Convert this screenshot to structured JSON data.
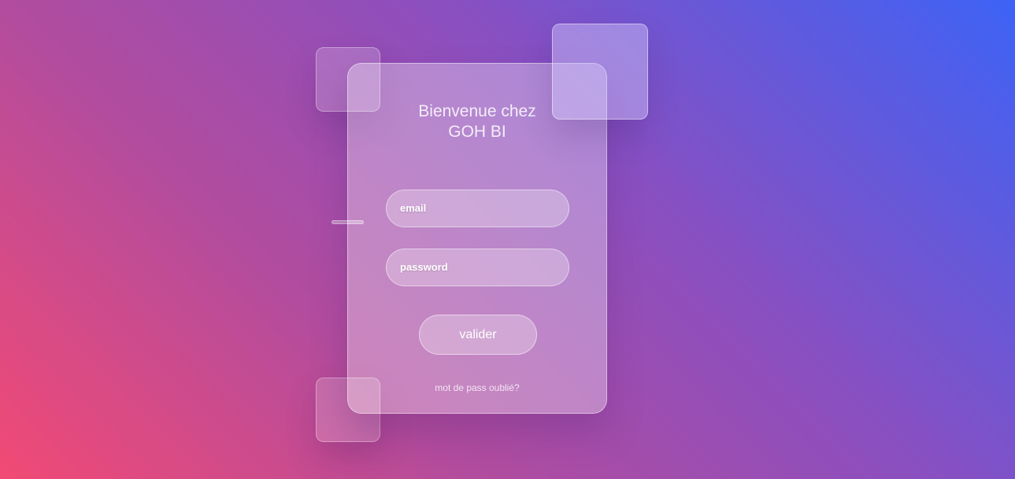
{
  "login": {
    "title_line1": "Bienvenue chez",
    "title_line2": "GOH BI",
    "email_placeholder": "email",
    "password_placeholder": "password",
    "submit_label": "valider",
    "forgot_link": "mot de pass oublié?"
  },
  "theme": {
    "gradient_start": "#f24a74",
    "gradient_mid": "#8a4fc0",
    "gradient_end": "#3d63f6",
    "glass_tint": "rgba(255,255,255,0.32)"
  }
}
